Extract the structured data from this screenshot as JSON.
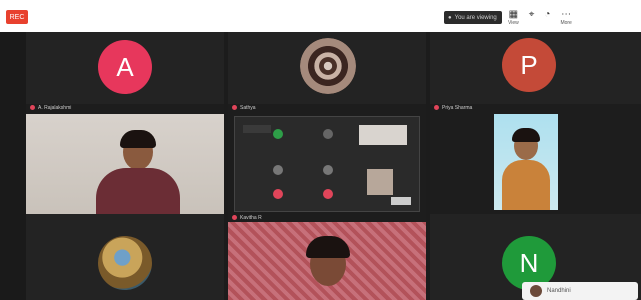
{
  "topbar": {
    "rec_label": "REC",
    "presenter_label": "You are viewing",
    "icons": [
      {
        "name": "grid-icon",
        "glyph": "▦",
        "label": "View"
      },
      {
        "name": "pin-icon",
        "glyph": "⌖",
        "label": ""
      },
      {
        "name": "sound-icon",
        "glyph": "◔",
        "label": ""
      },
      {
        "name": "more-icon",
        "glyph": "⋯",
        "label": "More"
      }
    ]
  },
  "tiles": [
    {
      "id": "tile-a",
      "type": "avatar",
      "initial": "A",
      "color": "#e7375c",
      "name": ""
    },
    {
      "id": "tile-pattern",
      "type": "avatar",
      "initial": "",
      "color": "#8a6a5a",
      "name": ""
    },
    {
      "id": "tile-p",
      "type": "avatar",
      "initial": "P",
      "color": "#c44a38",
      "name": ""
    },
    {
      "id": "tile-video-1",
      "type": "video",
      "name": "A. Rajalakshmi"
    },
    {
      "id": "tile-screen",
      "type": "screen",
      "name": "Sathya"
    },
    {
      "id": "tile-video-2",
      "type": "video",
      "name": "Priya Sharma"
    },
    {
      "id": "tile-photo",
      "type": "avatar",
      "initial": "",
      "color": "#b8872f",
      "name": ""
    },
    {
      "id": "tile-video-3",
      "type": "video",
      "name": "Kavitha R"
    },
    {
      "id": "tile-n",
      "type": "avatar",
      "initial": "N",
      "color": "#1f9a3a",
      "name": ""
    }
  ],
  "bottom_card": {
    "label": "Nandhini"
  }
}
